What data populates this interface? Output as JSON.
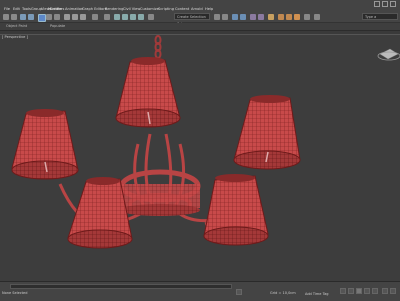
{
  "menu": {
    "items": [
      "File",
      "Edit",
      "Tools",
      "Group",
      "Views",
      "Create",
      "Modifiers",
      "Animation",
      "Graph Editors",
      "Rendering",
      "Civil View",
      "Customize",
      "Scripting",
      "Content",
      "Arnold",
      "Help"
    ]
  },
  "toolbar": {
    "selection_set": "Create Selection Set",
    "search_label": "Type a"
  },
  "subbar": {
    "left_labels": [
      "Object Paint",
      "Populate"
    ]
  },
  "viewport": {
    "label": "[ Perspective ]"
  },
  "status": {
    "left_text": "None Selected",
    "coords": "Grid = 10,0cm",
    "add_time_tag": "Add Time Tag"
  },
  "colors": {
    "wire": "#c84040",
    "wire_dark": "#7a1e1e",
    "background": "#3d3d3d"
  }
}
